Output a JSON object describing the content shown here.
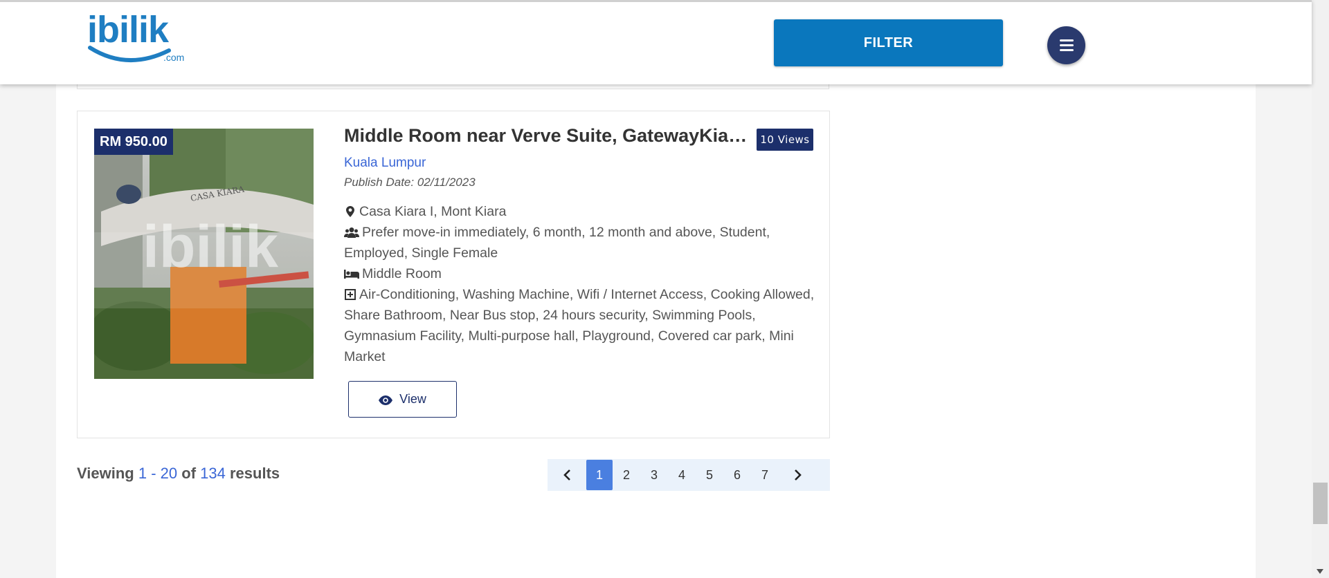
{
  "header": {
    "logo_text": "ibilik",
    "logo_suffix": ".com",
    "filter_label": "FILTER",
    "menu_icon": "hamburger-icon"
  },
  "listing": {
    "price": "RM 950.00",
    "title": "Middle Room near Verve Suite, GatewayKiara, Plaza Mont Kiara",
    "views": "10 Views",
    "location": "Kuala Lumpur",
    "publish_date": "Publish Date: 02/11/2023",
    "address": "Casa Kiara I, Mont Kiara",
    "preferences": "Prefer move-in immediately, 6 month, 12 month and above, Student, Employed, Single Female",
    "room_type": "Middle Room",
    "facilities": "Air-Conditioning, Washing Machine, Wifi / Internet Access, Cooking Allowed, Share Bathroom, Near Bus stop, 24 hours security, Swimming Pools, Gymnasium Facility, Multi-purpose hall, Playground, Covered car park, Mini Market",
    "view_label": "View",
    "photo_watermark": "ibilik",
    "icons": {
      "address": "map-marker-icon",
      "preferences": "users-icon",
      "room_type": "bed-icon",
      "facilities": "plus-square-icon",
      "view": "eye-icon"
    }
  },
  "results": {
    "prefix": "Viewing",
    "range": "1 - 20",
    "of": "of",
    "total": "134",
    "suffix": "results"
  },
  "pagination": {
    "pages": [
      "1",
      "2",
      "3",
      "4",
      "5",
      "6",
      "7"
    ],
    "active": "1"
  },
  "colors": {
    "brand_blue": "#0a77bd",
    "navy": "#1c2f6b",
    "link_blue": "#3a66d6",
    "pager_active": "#4a7fe0",
    "pager_bg": "#eaf2fb"
  }
}
